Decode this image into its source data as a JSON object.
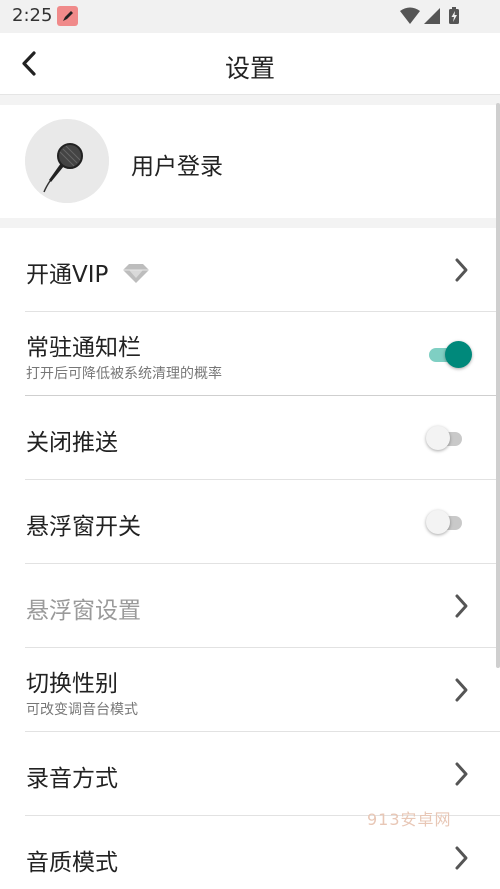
{
  "status_bar": {
    "time": "2:25",
    "icons": [
      "app-notification-icon",
      "wifi-icon",
      "signal-icon",
      "battery-charging-icon"
    ]
  },
  "header": {
    "title": "设置",
    "back_icon": "back-arrow-icon"
  },
  "user": {
    "label": "用户登录",
    "avatar_icon": "microphone-icon"
  },
  "settings": [
    {
      "title": "开通VIP",
      "icon": "diamond-icon",
      "control": "chevron"
    },
    {
      "title": "常驻通知栏",
      "subtitle": "打开后可降低被系统清理的概率",
      "control": "toggle",
      "on": true
    },
    {
      "title": "关闭推送",
      "control": "toggle",
      "on": false
    },
    {
      "title": "悬浮窗开关",
      "control": "toggle",
      "on": false
    },
    {
      "title": "悬浮窗设置",
      "control": "chevron",
      "disabled": true
    },
    {
      "title": "切换性别",
      "subtitle": "可改变调音台模式",
      "control": "chevron"
    },
    {
      "title": "录音方式",
      "control": "chevron"
    },
    {
      "title": "音质模式",
      "control": "chevron"
    }
  ],
  "watermark": "913安卓网",
  "colors": {
    "accent": "#00897b",
    "accent_track": "#7fcfc3",
    "background_gap": "#f3f3f3",
    "disabled_text": "#9a9a9a"
  }
}
